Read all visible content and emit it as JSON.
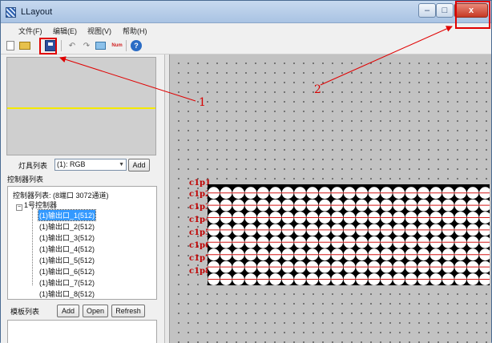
{
  "window": {
    "title": "LLayout",
    "controls": {
      "minimize": "–",
      "maximize": "□",
      "close": "x"
    }
  },
  "menu": [
    {
      "label": "文件(F)"
    },
    {
      "label": "编辑(E)"
    },
    {
      "label": "视图(V)"
    },
    {
      "label": "帮助(H)"
    }
  ],
  "toolbar": {
    "icons": [
      "new-file-icon",
      "open-folder-icon",
      "save-icon",
      "undo-icon",
      "redo-icon",
      "screen-icon",
      "num-icon",
      "help-icon"
    ],
    "undo_glyph": "↶",
    "redo_glyph": "↷",
    "num_label": "Num",
    "help_glyph": "?"
  },
  "fixtures": {
    "label": "灯具列表",
    "selected": "(1): RGB",
    "add_label": "Add"
  },
  "controllers": {
    "section_label": "控制器列表",
    "root_label": "控制器列表: (8端口 3072通道)",
    "controller_label": "1号控制器",
    "root_toggle": "−",
    "controller_toggle": "−",
    "ports": [
      {
        "label": "(1)输出口_1(512)",
        "selected": true
      },
      {
        "label": "(1)输出口_2(512)",
        "selected": false
      },
      {
        "label": "(1)输出口_3(512)",
        "selected": false
      },
      {
        "label": "(1)输出口_4(512)",
        "selected": false
      },
      {
        "label": "(1)输出口_5(512)",
        "selected": false
      },
      {
        "label": "(1)输出口_6(512)",
        "selected": false
      },
      {
        "label": "(1)输出口_7(512)",
        "selected": false
      },
      {
        "label": "(1)输出口_8(512)",
        "selected": false
      }
    ]
  },
  "templates": {
    "label": "模板列表",
    "add_label": "Add",
    "open_label": "Open",
    "refresh_label": "Refresh"
  },
  "canvas": {
    "row_labels": [
      "c1p1",
      "c1p2",
      "c1p3",
      "c1p4",
      "c1p5",
      "c1p6",
      "c1p7",
      "c1p8"
    ]
  },
  "annotations": {
    "marker_1": "1",
    "marker_2": "2"
  },
  "colors": {
    "highlight": "#e00000",
    "selection": "#3399ff",
    "preview_line": "#f4ea00"
  }
}
